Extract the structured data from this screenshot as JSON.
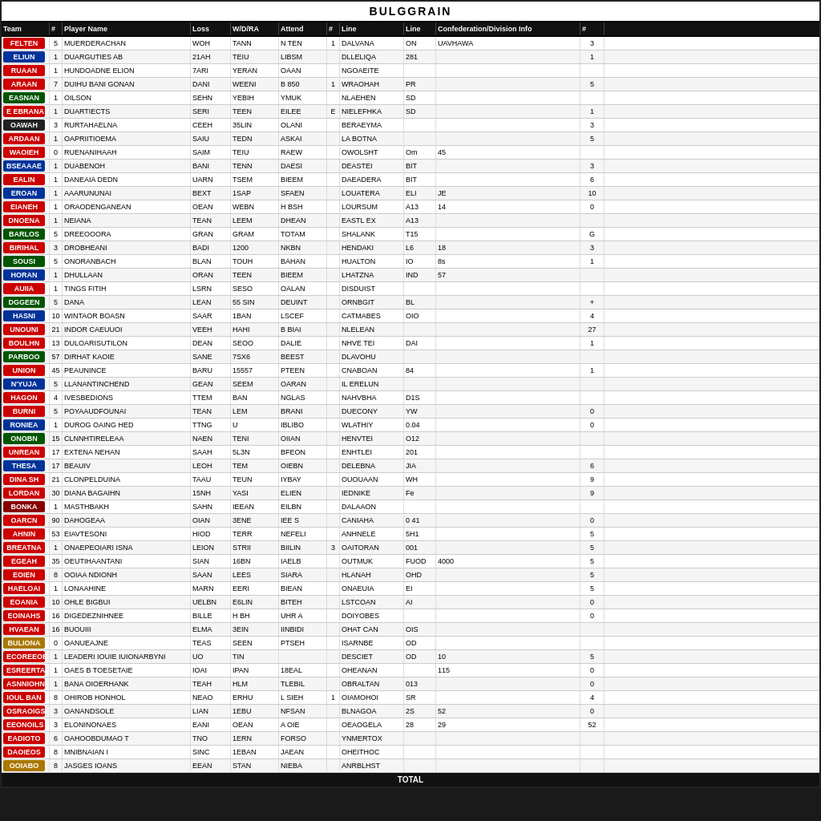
{
  "title": "BULGGRAIN",
  "columns": [
    "Team",
    "#",
    "Player Name",
    "Loss",
    "W/D/RA",
    "Attend",
    "#",
    "Line",
    "Line",
    "Confederation/Division Info",
    "#"
  ],
  "footer": "TOTAL",
  "rows": [
    {
      "team": "FELTEN",
      "teamColor": "red",
      "num": "5",
      "player": "MUERDERACHAN",
      "loss": "WOH",
      "wdra": "TANN",
      "attend": "N TEN",
      "n2": "1",
      "line": "DALVANA",
      "ln2": "ON",
      "conf": "UAVHAWA",
      "pts": "3"
    },
    {
      "team": "ELIUN",
      "teamColor": "blue",
      "num": "1",
      "player": "DUARGUTIES AB",
      "loss": "21AH",
      "wdra": "TEIU",
      "attend": "LIBSM",
      "n2": "",
      "line": "DLLELIQA",
      "ln2": "281",
      "conf": "",
      "pts": "1"
    },
    {
      "team": "RUAAN",
      "teamColor": "red",
      "num": "1",
      "player": "HUNDOADNE ELION",
      "loss": "7ARI",
      "wdra": "YERAN",
      "attend": "OAAN",
      "n2": "",
      "line": "NGOAEITE",
      "ln2": "",
      "conf": "",
      "pts": ""
    },
    {
      "team": "ARAAN",
      "teamColor": "red",
      "num": "7",
      "player": "DUIHU BANI GONAN",
      "loss": "DANI",
      "wdra": "WEENI",
      "attend": "B 850",
      "n2": "1",
      "line": "WRAOHAH",
      "ln2": "PR",
      "conf": "",
      "pts": "5"
    },
    {
      "team": "EASNAN",
      "teamColor": "green",
      "num": "1",
      "player": "OILSON",
      "loss": "SEHN",
      "wdra": "YEBIH",
      "attend": "YMUK",
      "n2": "",
      "line": "NLAEHEN",
      "ln2": "SD",
      "conf": "",
      "pts": ""
    },
    {
      "team": "E EBRANA",
      "teamColor": "red",
      "num": "1",
      "player": "DUARTIECTS",
      "loss": "SERI",
      "wdra": "TEEN",
      "attend": "EILEE",
      "n2": "E",
      "line": "NIELEFHKA",
      "ln2": "SD",
      "conf": "",
      "pts": "1"
    },
    {
      "team": "OAWAH",
      "teamColor": "dark",
      "num": "3",
      "player": "RURTAHAELNA",
      "loss": "CEEH",
      "wdra": "35LIN",
      "attend": "OLANI",
      "n2": "",
      "line": "BERAEYMA",
      "ln2": "",
      "conf": "",
      "pts": "3"
    },
    {
      "team": "ARDAAN",
      "teamColor": "red",
      "num": "1",
      "player": "OAPRIITIOEMA",
      "loss": "SAIU",
      "wdra": "TEDN",
      "attend": "ASKAI",
      "n2": "",
      "line": "LA BOTNA",
      "ln2": "",
      "conf": "",
      "pts": "5"
    },
    {
      "team": "WAOIEH",
      "teamColor": "red",
      "num": "0",
      "player": "RUENANIHAAH",
      "loss": "SAIM",
      "wdra": "TEIU",
      "attend": "RAEW",
      "n2": "",
      "line": "OWOLSHT",
      "ln2": "Om",
      "conf": "45",
      "pts": ""
    },
    {
      "team": "BSEAAAE",
      "teamColor": "blue",
      "num": "1",
      "player": "DUABENOH",
      "loss": "BANI",
      "wdra": "TENN",
      "attend": "DAESI",
      "n2": "",
      "line": "DEASTEI",
      "ln2": "BIT",
      "conf": "",
      "pts": "3"
    },
    {
      "team": "EALIN",
      "teamColor": "red",
      "num": "1",
      "player": "DANEAIA DEDN",
      "loss": "UARN",
      "wdra": "TSEM",
      "attend": "BIEEM",
      "n2": "",
      "line": "DAEADERA",
      "ln2": "BIT",
      "conf": "",
      "pts": "6"
    },
    {
      "team": "EROAN",
      "teamColor": "blue",
      "num": "1",
      "player": "AAARUNUNAI",
      "loss": "BEXT",
      "wdra": "1SAP",
      "attend": "SFAEN",
      "n2": "",
      "line": "LOUATERA",
      "ln2": "ELI",
      "conf": "JE",
      "pts": "10"
    },
    {
      "team": "EIANEH",
      "teamColor": "red",
      "num": "1",
      "player": "ORAODENGANEAN",
      "loss": "OEAN",
      "wdra": "WEBN",
      "attend": "H BSH",
      "n2": "",
      "line": "LOURSUM",
      "ln2": "A13",
      "conf": "14",
      "pts": "0"
    },
    {
      "team": "DNOENA",
      "teamColor": "red",
      "num": "1",
      "player": "NEIANA",
      "loss": "TEAN",
      "wdra": "LEEM",
      "attend": "DHEAN",
      "n2": "",
      "line": "EASTL EX",
      "ln2": "A13",
      "conf": "",
      "pts": ""
    },
    {
      "team": "BARLOS",
      "teamColor": "green",
      "num": "5",
      "player": "DREEOOORA",
      "loss": "GRAN",
      "wdra": "GRAM",
      "attend": "TOTAM",
      "n2": "",
      "line": "SHALANK",
      "ln2": "T15",
      "conf": "",
      "pts": "G"
    },
    {
      "team": "BIRIHAL",
      "teamColor": "red",
      "num": "3",
      "player": "DROBHEANI",
      "loss": "BADI",
      "wdra": "1200",
      "attend": "NKBN",
      "n2": "",
      "line": "HENDAKI",
      "ln2": "L6",
      "conf": "18",
      "pts": "3"
    },
    {
      "team": "SOUSI",
      "teamColor": "green",
      "num": "5",
      "player": "ONORANBACH",
      "loss": "BLAN",
      "wdra": "TOUH",
      "attend": "BAHAN",
      "n2": "",
      "line": "HUALTON",
      "ln2": "IO",
      "conf": "8s",
      "pts": "1"
    },
    {
      "team": "HORAN",
      "teamColor": "blue",
      "num": "1",
      "player": "DHULLAAN",
      "loss": "ORAN",
      "wdra": "TEEN",
      "attend": "BIEEM",
      "n2": "",
      "line": "LHATZNA",
      "ln2": "IND",
      "conf": "57",
      "pts": ""
    },
    {
      "team": "AUIIA",
      "teamColor": "red",
      "num": "1",
      "player": "TINGS FITIH",
      "loss": "LSRN",
      "wdra": "SESO",
      "attend": "OALAN",
      "n2": "",
      "line": "DISDUIST",
      "ln2": "",
      "conf": "",
      "pts": ""
    },
    {
      "team": "DGGEEN",
      "teamColor": "green",
      "num": "5",
      "player": "DANA",
      "loss": "LEAN",
      "wdra": "55 SIN",
      "attend": "DEUINT",
      "n2": "",
      "line": "ORNBGIT",
      "ln2": "BL",
      "conf": "",
      "pts": "+"
    },
    {
      "team": "HASNI",
      "teamColor": "blue",
      "num": "10",
      "player": "WINTAOR BOASN",
      "loss": "SAAR",
      "wdra": "1BAN",
      "attend": "LSCEF",
      "n2": "",
      "line": "CATMABES",
      "ln2": "OIO",
      "conf": "",
      "pts": "4"
    },
    {
      "team": "UNOUNI",
      "teamColor": "red",
      "num": "21",
      "player": "INDOR CAEUUOI",
      "loss": "VEEH",
      "wdra": "HAHI",
      "attend": "B BIAI",
      "n2": "",
      "line": "NLELEAN",
      "ln2": "",
      "conf": "",
      "pts": "27"
    },
    {
      "team": "BOULHN",
      "teamColor": "red",
      "num": "13",
      "player": "DULOARISUTILON",
      "loss": "DEAN",
      "wdra": "SEOO",
      "attend": "DALIE",
      "n2": "",
      "line": "NHVE TEI",
      "ln2": "DAI",
      "conf": "",
      "pts": "1"
    },
    {
      "team": "PARBOO",
      "teamColor": "green",
      "num": "57",
      "player": "DIRHAT KAOIE",
      "loss": "SANE",
      "wdra": "7SX6",
      "attend": "BEEST",
      "n2": "",
      "line": "DLAVOHU",
      "ln2": "",
      "conf": "",
      "pts": ""
    },
    {
      "team": "UNION",
      "teamColor": "red",
      "num": "45",
      "player": "PEAUNINCE",
      "loss": "BARU",
      "wdra": "15557",
      "attend": "PTEEN",
      "n2": "",
      "line": "CNABOAN",
      "ln2": "84",
      "conf": "",
      "pts": "1"
    },
    {
      "team": "N'YUJA",
      "teamColor": "blue",
      "num": "5",
      "player": "LLANANTINCHEND",
      "loss": "GEAN",
      "wdra": "SEEM",
      "attend": "OARAN",
      "n2": "",
      "line": "IL ERELUN",
      "ln2": "",
      "conf": "",
      "pts": ""
    },
    {
      "team": "HAGON",
      "teamColor": "red",
      "num": "4",
      "player": "IVESBEDIONS",
      "loss": "TTEM",
      "wdra": "BAN",
      "attend": "NGLAS",
      "n2": "",
      "line": "NAHVBHA",
      "ln2": "D1S",
      "conf": "",
      "pts": ""
    },
    {
      "team": "BURNI",
      "teamColor": "red",
      "num": "5",
      "player": "POYAAUDFOUNAI",
      "loss": "TEAN",
      "wdra": "LEM",
      "attend": "BRANI",
      "n2": "",
      "line": "DUECONY",
      "ln2": "YW",
      "conf": "",
      "pts": "0"
    },
    {
      "team": "RONIEA",
      "teamColor": "blue",
      "num": "1",
      "player": "DUROG OAING HED",
      "loss": "TTNG",
      "wdra": "U",
      "attend": "IBLIBO",
      "n2": "",
      "line": "WLATHIY",
      "ln2": "0.04",
      "conf": "",
      "pts": "0"
    },
    {
      "team": "ONOBN",
      "teamColor": "green",
      "num": "15",
      "player": "CLNNHTIRELEAA",
      "loss": "NAEN",
      "wdra": "TENI",
      "attend": "OIIAN",
      "n2": "",
      "line": "HENVTEI",
      "ln2": "O12",
      "conf": "",
      "pts": ""
    },
    {
      "team": "UNREAN",
      "teamColor": "red",
      "num": "17",
      "player": "EXTENA NEHAN",
      "loss": "SAAH",
      "wdra": "5L3N",
      "attend": "BFEON",
      "n2": "",
      "line": "ENHTLEI",
      "ln2": "201",
      "conf": "",
      "pts": ""
    },
    {
      "team": "THESA",
      "teamColor": "blue",
      "num": "17",
      "player": "BEAUIV",
      "loss": "LEOH",
      "wdra": "TEM",
      "attend": "OIEBN",
      "n2": "",
      "line": "DELEBNA",
      "ln2": "JIA",
      "conf": "",
      "pts": "6"
    },
    {
      "team": "DINA SH",
      "teamColor": "red",
      "num": "21",
      "player": "CLONPELDUINA",
      "loss": "TAAU",
      "wdra": "TEUN",
      "attend": "IYBAY",
      "n2": "",
      "line": "OUOUAAN",
      "ln2": "WH",
      "conf": "",
      "pts": "9"
    },
    {
      "team": "LORDAN",
      "teamColor": "red",
      "num": "30",
      "player": "DIANA BAGAIHN",
      "loss": "15NH",
      "wdra": "YASI",
      "attend": "ELIEN",
      "n2": "",
      "line": "IEDNIKE",
      "ln2": "Fe",
      "conf": "",
      "pts": "9"
    },
    {
      "team": "BONKA",
      "teamColor": "darkred",
      "num": "1",
      "player": "MASTHBAKH",
      "loss": "SAHN",
      "wdra": "IEEAN",
      "attend": "EILBN",
      "n2": "",
      "line": "DALAAON",
      "ln2": "",
      "conf": "",
      "pts": ""
    },
    {
      "team": "OARCN",
      "teamColor": "red",
      "num": "90",
      "player": "DAHOGEAA",
      "loss": "OIAN",
      "wdra": "3ENE",
      "attend": "IEE S",
      "n2": "",
      "line": "CANIAHA",
      "ln2": "0 41",
      "conf": "",
      "pts": "0"
    },
    {
      "team": "AHNIN",
      "teamColor": "red",
      "num": "53",
      "player": "EIAVTESONI",
      "loss": "HIOD",
      "wdra": "TERR",
      "attend": "NEFELI",
      "n2": "",
      "line": "ANHNELE",
      "ln2": "5H1",
      "conf": "",
      "pts": "5"
    },
    {
      "team": "BREATNA",
      "teamColor": "red",
      "num": "1",
      "player": "ONAEPEOIARI ISNA",
      "loss": "LEION",
      "wdra": "STRII",
      "attend": "BIILIN",
      "n2": "3",
      "line": "OAITORAN",
      "ln2": "001",
      "conf": "",
      "pts": "5"
    },
    {
      "team": "EGEAH",
      "teamColor": "red",
      "num": "35",
      "player": "OEUTIHAANTANI",
      "loss": "SIAN",
      "wdra": "16BN",
      "attend": "IAELB",
      "n2": "",
      "line": "OUTMUK",
      "ln2": "FUOD",
      "conf": "4000",
      "pts": "5"
    },
    {
      "team": "EOIEN",
      "teamColor": "red",
      "num": "8",
      "player": "OOIAA NDIONH",
      "loss": "SAAN",
      "wdra": "LEES",
      "attend": "SIARA",
      "n2": "",
      "line": "HLANAH",
      "ln2": "OHD",
      "conf": "",
      "pts": "5"
    },
    {
      "team": "HAELOAI",
      "teamColor": "red",
      "num": "1",
      "player": "LONAAHINE",
      "loss": "MARN",
      "wdra": "EERI",
      "attend": "BIEAN",
      "n2": "",
      "line": "ONAEUIA",
      "ln2": "EI",
      "conf": "",
      "pts": "5"
    },
    {
      "team": "EOANIA",
      "teamColor": "red",
      "num": "10",
      "player": "OHLE BIGBUI",
      "loss": "UELBN",
      "wdra": "E6LIN",
      "attend": "BITEH",
      "n2": "",
      "line": "LSTCOAN",
      "ln2": "AI",
      "conf": "",
      "pts": "0"
    },
    {
      "team": "EOINAHS",
      "teamColor": "red",
      "num": "16",
      "player": "DIGEDEZNIHNEE",
      "loss": "BILLE",
      "wdra": "H BH",
      "attend": "UHR A",
      "n2": "",
      "line": "DOIYOBES",
      "ln2": "",
      "conf": "",
      "pts": "0"
    },
    {
      "team": "HVAEAN",
      "teamColor": "red",
      "num": "16",
      "player": "BUOUIII",
      "loss": "ELMA",
      "wdra": "3EIN",
      "attend": "IINBIDI",
      "n2": "",
      "line": "OHAT CAN",
      "ln2": "OIS",
      "conf": "",
      "pts": ""
    },
    {
      "team": "BULIONA",
      "teamColor": "gold",
      "num": "0",
      "player": "OANUEAJNE",
      "loss": "TEAS",
      "wdra": "SEEN",
      "attend": "PTSEH",
      "n2": "",
      "line": "ISARNBE",
      "ln2": "OD",
      "conf": "",
      "pts": ""
    },
    {
      "team": "ECOREEOE",
      "teamColor": "red",
      "num": "1",
      "player": "LEADERI IOUIE IUIONARBYNI",
      "loss": "UO",
      "wdra": "TIN",
      "attend": "",
      "n2": "",
      "line": "DESCIET",
      "ln2": "OD",
      "conf": "10",
      "pts": "5"
    },
    {
      "team": "ESREERTAH",
      "teamColor": "red",
      "num": "1",
      "player": "OAES B TOESETAIE",
      "loss": "IOAI",
      "wdra": "IPAN",
      "attend": "18EAL",
      "n2": "",
      "line": "OHEANAN",
      "ln2": "",
      "conf": "115",
      "pts": "0"
    },
    {
      "team": "ASNNIOHN",
      "teamColor": "red",
      "num": "1",
      "player": "BANA OIOERHANK",
      "loss": "TEAH",
      "wdra": "HLM",
      "attend": "TLEBIL",
      "n2": "",
      "line": "OBRALTAN",
      "ln2": "013",
      "conf": "",
      "pts": "0"
    },
    {
      "team": "IOUL BAN",
      "teamColor": "red",
      "num": "8",
      "player": "OHIROB HONHOL",
      "loss": "NEAO",
      "wdra": "ERHU",
      "attend": "L SIEH",
      "n2": "1",
      "line": "OIAMOHOI",
      "ln2": "SR",
      "conf": "",
      "pts": "4"
    },
    {
      "team": "OSRAOIGS",
      "teamColor": "red",
      "num": "3",
      "player": "OANANDSOLE",
      "loss": "LIAN",
      "wdra": "1EBU",
      "attend": "NFSAN",
      "n2": "",
      "line": "BLNAGOA",
      "ln2": "2S",
      "conf": "52",
      "pts": "0"
    },
    {
      "team": "EEONOILS",
      "teamColor": "red",
      "num": "3",
      "player": "ELONINONAES",
      "loss": "EANI",
      "wdra": "OEAN",
      "attend": "A OIE",
      "n2": "",
      "line": "OEAOGELA",
      "ln2": "28",
      "conf": "29",
      "pts": "52"
    },
    {
      "team": "EADIOTO",
      "teamColor": "red",
      "num": "6",
      "player": "OAHOOBDUMAO T",
      "loss": "TNO",
      "wdra": "1ERN",
      "attend": "FORSO",
      "n2": "",
      "line": "YNMERTOX",
      "ln2": "",
      "conf": "",
      "pts": ""
    },
    {
      "team": "DAOIEOS",
      "teamColor": "red",
      "num": "8",
      "player": "MNIBNAIAN I",
      "loss": "SINC",
      "wdra": "1EBAN",
      "attend": "JAEAN",
      "n2": "",
      "line": "OHEITHOC",
      "ln2": "",
      "conf": "",
      "pts": ""
    },
    {
      "team": "OOIABO",
      "teamColor": "gold",
      "num": "8",
      "player": "JASGES IOANS",
      "loss": "EEAN",
      "wdra": "STAN",
      "attend": "NIEBA",
      "n2": "",
      "line": "ANRBLHST",
      "ln2": "",
      "conf": "",
      "pts": ""
    }
  ]
}
